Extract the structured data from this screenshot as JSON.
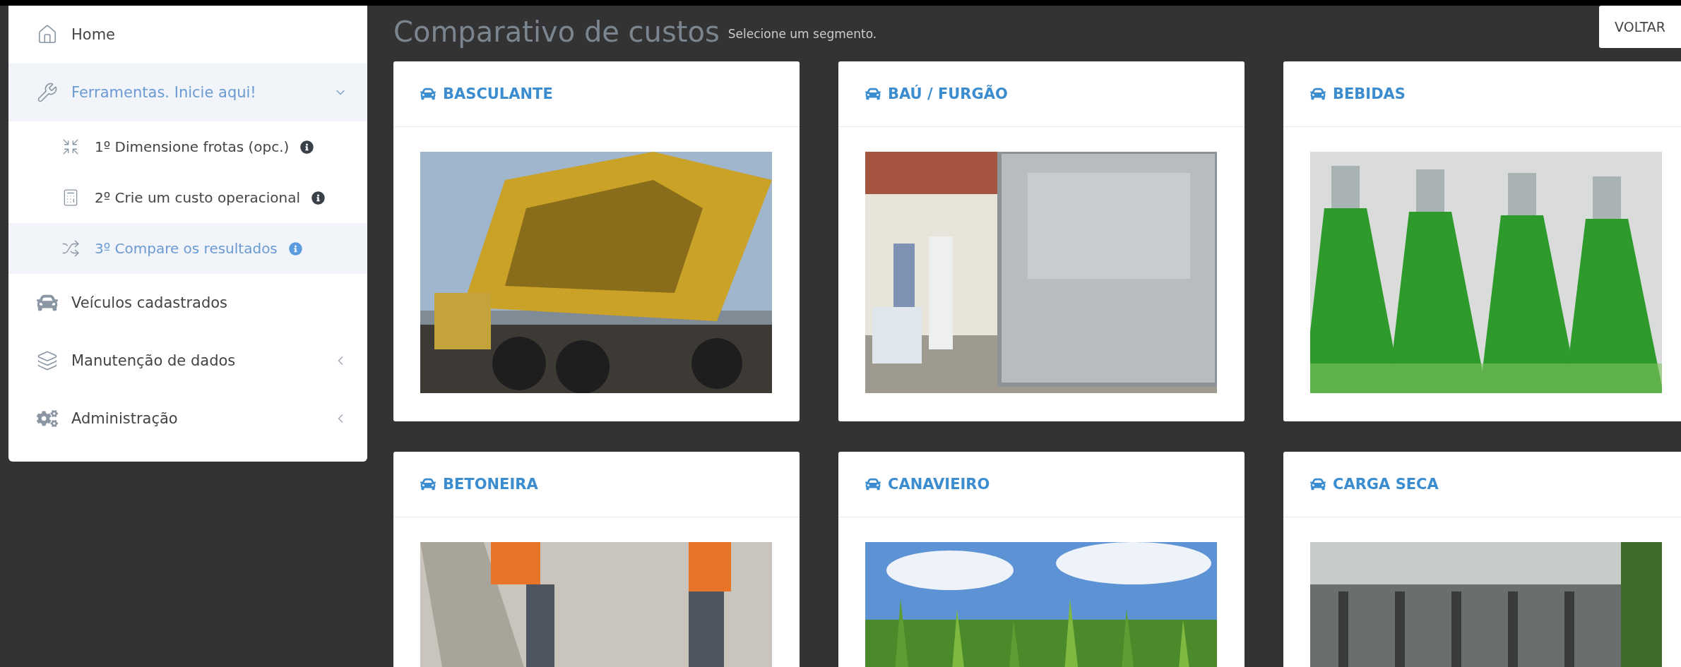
{
  "sidebar": {
    "items": [
      {
        "kind": "link",
        "label": "Home"
      },
      {
        "kind": "group",
        "label": "Ferramentas. Inicie aqui!",
        "expanded": true,
        "children": [
          {
            "label": "1º Dimensione frotas (opc.)",
            "selected": false
          },
          {
            "label": "2º Crie um custo operacional",
            "selected": false
          },
          {
            "label": "3º Compare os resultados",
            "selected": true
          }
        ]
      },
      {
        "kind": "link",
        "label": "Veículos cadastrados"
      },
      {
        "kind": "group",
        "label": "Manutenção de dados",
        "expanded": false
      },
      {
        "kind": "group",
        "label": "Administração",
        "expanded": false
      }
    ]
  },
  "page": {
    "title": "Comparativo de custos",
    "subtitle": "Selecione um segmento.",
    "back_button": "VOLTAR"
  },
  "segments": [
    {
      "label": "BASCULANTE"
    },
    {
      "label": "BAÚ / FURGÃO"
    },
    {
      "label": "BEBIDAS"
    },
    {
      "label": "BETONEIRA"
    },
    {
      "label": "CANAVIEIRO"
    },
    {
      "label": "CARGA SECA"
    }
  ]
}
